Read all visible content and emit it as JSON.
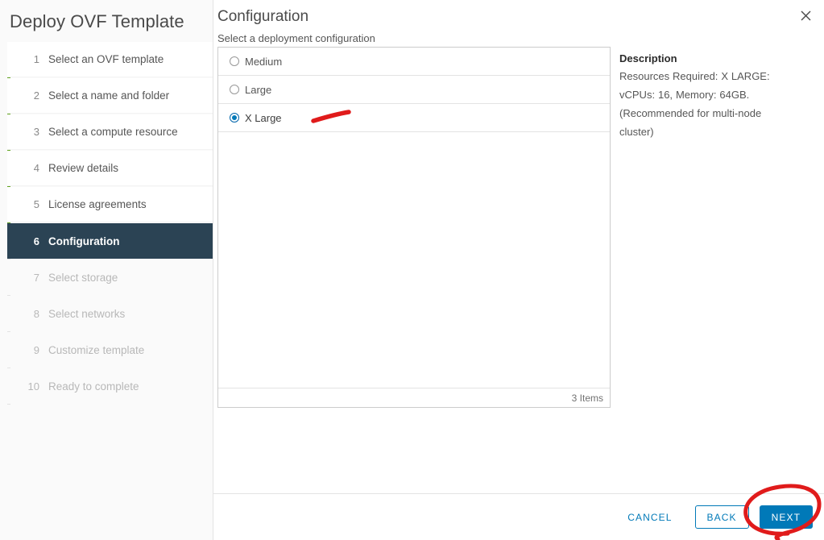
{
  "window": {
    "title": "Deploy OVF Template",
    "close_icon": "close-icon"
  },
  "sidebar": {
    "progress_steps_complete": 5,
    "items": [
      {
        "num": "1",
        "label": "Select an OVF template",
        "state": "done"
      },
      {
        "num": "2",
        "label": "Select a name and folder",
        "state": "done"
      },
      {
        "num": "3",
        "label": "Select a compute resource",
        "state": "done"
      },
      {
        "num": "4",
        "label": "Review details",
        "state": "done"
      },
      {
        "num": "5",
        "label": "License agreements",
        "state": "done"
      },
      {
        "num": "6",
        "label": "Configuration",
        "state": "active"
      },
      {
        "num": "7",
        "label": "Select storage",
        "state": "pending"
      },
      {
        "num": "8",
        "label": "Select networks",
        "state": "pending"
      },
      {
        "num": "9",
        "label": "Customize template",
        "state": "pending"
      },
      {
        "num": "10",
        "label": "Ready to complete",
        "state": "pending"
      }
    ]
  },
  "main": {
    "title": "Configuration",
    "subtitle": "Select a deployment configuration",
    "options": [
      {
        "label": "Medium",
        "selected": false
      },
      {
        "label": "Large",
        "selected": false
      },
      {
        "label": "X Large",
        "selected": true
      }
    ],
    "item_count_label": "3 Items",
    "description": {
      "heading": "Description",
      "text": "Resources Required: X LARGE: vCPUs: 16, Memory: 64GB. (Recommended for multi-node cluster)"
    }
  },
  "footer": {
    "cancel_label": "CANCEL",
    "back_label": "BACK",
    "next_label": "NEXT"
  },
  "colors": {
    "accent_blue": "#0079b8",
    "active_nav": "#2b4354",
    "progress_green": "#62a420",
    "annotation_red": "#e01b1b"
  },
  "annotations": [
    {
      "name": "red-underline-stroke",
      "target": "X Large option"
    },
    {
      "name": "red-circle-highlight",
      "target": "NEXT button"
    }
  ]
}
